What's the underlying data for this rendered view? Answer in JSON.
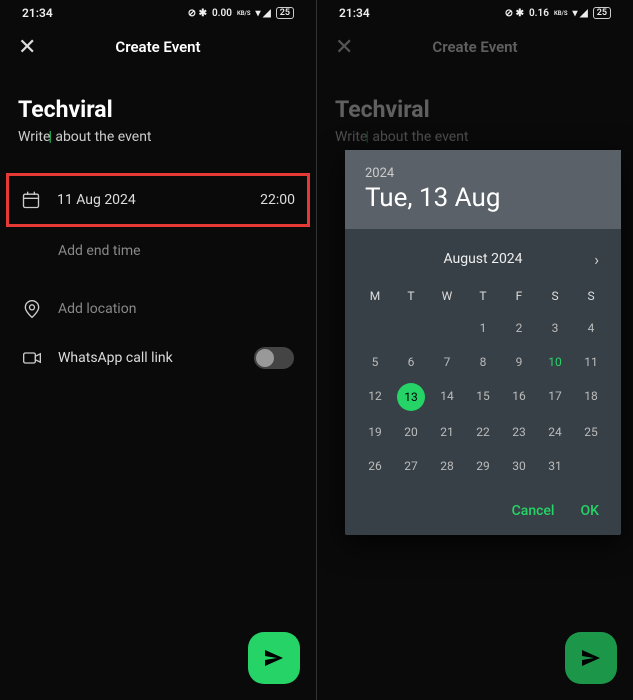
{
  "status": {
    "time": "21:34",
    "net_left": "0.00",
    "net_right": "0.16",
    "kbs": "KB/S",
    "battery": "25"
  },
  "header": {
    "title": "Create Event"
  },
  "event": {
    "name": "Techviral",
    "desc_prefix": "Write",
    "desc_suffix": " about the event"
  },
  "rows": {
    "date": "11 Aug 2024",
    "time": "22:00",
    "add_end": "Add end time",
    "location": "Add location",
    "call_link": "WhatsApp call link"
  },
  "picker": {
    "year": "2024",
    "selected_label": "Tue, 13 Aug",
    "month_label": "August 2024",
    "weekdays": [
      "M",
      "T",
      "W",
      "T",
      "F",
      "S",
      "S"
    ],
    "weeks": [
      [
        "",
        "",
        "",
        "1",
        "2",
        "3",
        "4"
      ],
      [
        "5",
        "6",
        "7",
        "8",
        "9",
        "10",
        "11"
      ],
      [
        "12",
        "13",
        "14",
        "15",
        "16",
        "17",
        "18"
      ],
      [
        "19",
        "20",
        "21",
        "22",
        "23",
        "24",
        "25"
      ],
      [
        "26",
        "27",
        "28",
        "29",
        "30",
        "31",
        ""
      ]
    ],
    "today": "10",
    "selected": "13",
    "cancel": "Cancel",
    "ok": "OK"
  }
}
